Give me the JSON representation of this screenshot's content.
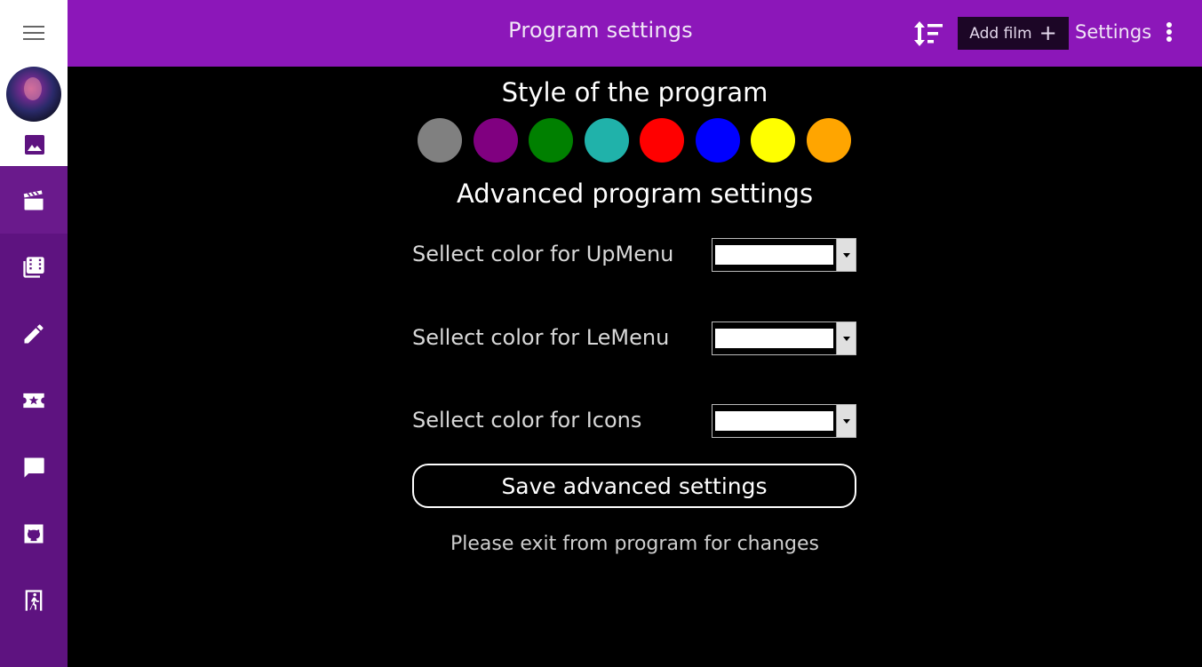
{
  "header": {
    "title": "Program settings",
    "sort_icon": "sort-icon",
    "add_film_label": "Add film",
    "add_film_icon": "+",
    "settings_label": "Settings",
    "more_icon": "more-vertical-icon"
  },
  "sidebar": {
    "menu_icon": "hamburger-icon",
    "avatar": "user-avatar",
    "gallery_icon": "image-icon",
    "items": [
      {
        "icon": "clapperboard-icon",
        "active": true
      },
      {
        "icon": "film-library-icon",
        "active": false
      },
      {
        "icon": "pencil-icon",
        "active": false
      },
      {
        "icon": "ticket-star-icon",
        "active": false
      },
      {
        "icon": "chat-bubble-icon",
        "active": false
      },
      {
        "icon": "github-icon",
        "active": false
      },
      {
        "icon": "exit-door-icon",
        "active": false
      }
    ]
  },
  "main": {
    "style_title": "Style of the program",
    "style_colors": [
      "#808080",
      "#800080",
      "#008000",
      "#20b2aa",
      "#ff0000",
      "#0000ff",
      "#ffff00",
      "#ffa500"
    ],
    "advanced_title": "Advanced program settings",
    "color_rows": [
      {
        "label": "Sellect color for UpMenu",
        "selected_value": ""
      },
      {
        "label": "Sellect color for LeMenu",
        "selected_value": ""
      },
      {
        "label": "Sellect color for Icons",
        "selected_value": ""
      }
    ],
    "save_label": "Save advanced settings",
    "note": "Please exit from program for changes"
  },
  "colors": {
    "header_bg": "#8c17b9",
    "sidebar_bg": "#5e1380",
    "content_bg": "#000000"
  }
}
